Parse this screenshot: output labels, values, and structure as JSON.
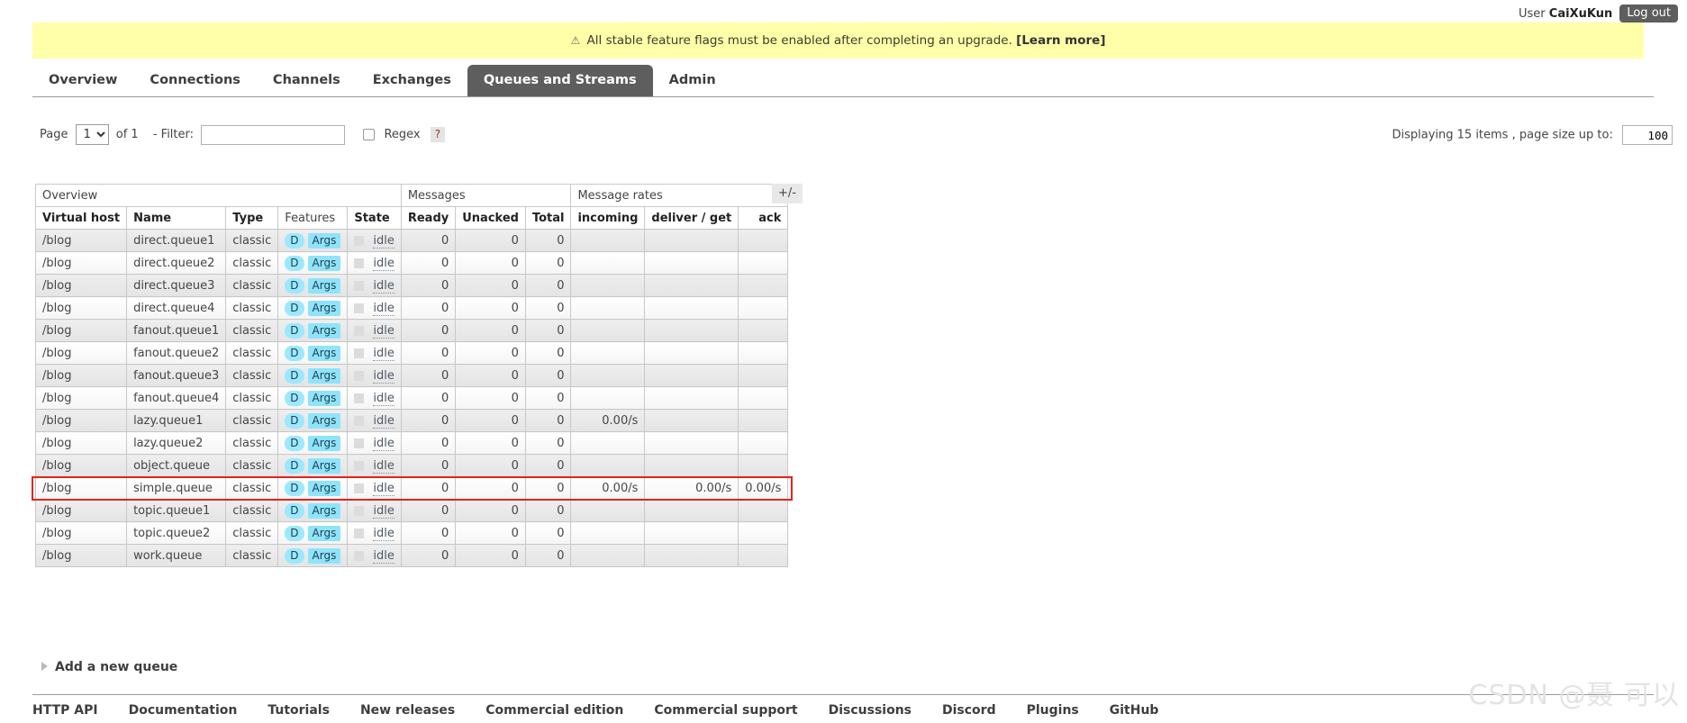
{
  "topbar": {
    "user_label": "User",
    "user_name": "CaiXuKun",
    "logout_label": "Log out"
  },
  "banner": {
    "warn_icon": "warning-triangle-icon",
    "warn_glyph": "⚠",
    "message": "All stable feature flags must be enabled after completing an upgrade.",
    "learn_more": "[Learn more]"
  },
  "tabs": [
    {
      "label": "Overview",
      "active": false
    },
    {
      "label": "Connections",
      "active": false
    },
    {
      "label": "Channels",
      "active": false
    },
    {
      "label": "Exchanges",
      "active": false
    },
    {
      "label": "Queues and Streams",
      "active": true
    },
    {
      "label": "Admin",
      "active": false
    }
  ],
  "filter": {
    "page_label": "Page",
    "page_value": "1",
    "page_options": [
      "1"
    ],
    "of_label": "of 1",
    "filter_label": "- Filter:",
    "filter_value": "",
    "filter_placeholder": "",
    "regex_label": "Regex",
    "regex_checked": false,
    "help_label": "?",
    "displaying_text": "Displaying 15 items , page size up to:",
    "page_size_value": "100"
  },
  "table": {
    "group_headers": [
      {
        "label": "Overview",
        "span": 5
      },
      {
        "label": "Messages",
        "span": 3
      },
      {
        "label": "Message rates",
        "span": 3
      }
    ],
    "plus_minus": "+/-",
    "columns": [
      {
        "label": "Virtual host",
        "bold": true,
        "align": "left"
      },
      {
        "label": "Name",
        "bold": true,
        "align": "left"
      },
      {
        "label": "Type",
        "bold": true,
        "align": "left"
      },
      {
        "label": "Features",
        "bold": false,
        "align": "left"
      },
      {
        "label": "State",
        "bold": true,
        "align": "left"
      },
      {
        "label": "Ready",
        "bold": true,
        "align": "right"
      },
      {
        "label": "Unacked",
        "bold": true,
        "align": "right"
      },
      {
        "label": "Total",
        "bold": true,
        "align": "right"
      },
      {
        "label": "incoming",
        "bold": true,
        "align": "right"
      },
      {
        "label": "deliver / get",
        "bold": true,
        "align": "right"
      },
      {
        "label": "ack",
        "bold": true,
        "align": "right"
      }
    ],
    "feature_badges": {
      "durable": "D",
      "args": "Args"
    },
    "state_text": "idle",
    "rows": [
      {
        "vhost": "/blog",
        "name": "direct.queue1",
        "type": "classic",
        "state": "idle",
        "ready": "0",
        "unacked": "0",
        "total": "0",
        "incoming": "",
        "deliver_get": "",
        "ack": "",
        "highlighted": false
      },
      {
        "vhost": "/blog",
        "name": "direct.queue2",
        "type": "classic",
        "state": "idle",
        "ready": "0",
        "unacked": "0",
        "total": "0",
        "incoming": "",
        "deliver_get": "",
        "ack": "",
        "highlighted": false
      },
      {
        "vhost": "/blog",
        "name": "direct.queue3",
        "type": "classic",
        "state": "idle",
        "ready": "0",
        "unacked": "0",
        "total": "0",
        "incoming": "",
        "deliver_get": "",
        "ack": "",
        "highlighted": false
      },
      {
        "vhost": "/blog",
        "name": "direct.queue4",
        "type": "classic",
        "state": "idle",
        "ready": "0",
        "unacked": "0",
        "total": "0",
        "incoming": "",
        "deliver_get": "",
        "ack": "",
        "highlighted": false
      },
      {
        "vhost": "/blog",
        "name": "fanout.queue1",
        "type": "classic",
        "state": "idle",
        "ready": "0",
        "unacked": "0",
        "total": "0",
        "incoming": "",
        "deliver_get": "",
        "ack": "",
        "highlighted": false
      },
      {
        "vhost": "/blog",
        "name": "fanout.queue2",
        "type": "classic",
        "state": "idle",
        "ready": "0",
        "unacked": "0",
        "total": "0",
        "incoming": "",
        "deliver_get": "",
        "ack": "",
        "highlighted": false
      },
      {
        "vhost": "/blog",
        "name": "fanout.queue3",
        "type": "classic",
        "state": "idle",
        "ready": "0",
        "unacked": "0",
        "total": "0",
        "incoming": "",
        "deliver_get": "",
        "ack": "",
        "highlighted": false
      },
      {
        "vhost": "/blog",
        "name": "fanout.queue4",
        "type": "classic",
        "state": "idle",
        "ready": "0",
        "unacked": "0",
        "total": "0",
        "incoming": "",
        "deliver_get": "",
        "ack": "",
        "highlighted": false
      },
      {
        "vhost": "/blog",
        "name": "lazy.queue1",
        "type": "classic",
        "state": "idle",
        "ready": "0",
        "unacked": "0",
        "total": "0",
        "incoming": "0.00/s",
        "deliver_get": "",
        "ack": "",
        "highlighted": false
      },
      {
        "vhost": "/blog",
        "name": "lazy.queue2",
        "type": "classic",
        "state": "idle",
        "ready": "0",
        "unacked": "0",
        "total": "0",
        "incoming": "",
        "deliver_get": "",
        "ack": "",
        "highlighted": false
      },
      {
        "vhost": "/blog",
        "name": "object.queue",
        "type": "classic",
        "state": "idle",
        "ready": "0",
        "unacked": "0",
        "total": "0",
        "incoming": "",
        "deliver_get": "",
        "ack": "",
        "highlighted": false
      },
      {
        "vhost": "/blog",
        "name": "simple.queue",
        "type": "classic",
        "state": "idle",
        "ready": "0",
        "unacked": "0",
        "total": "0",
        "incoming": "0.00/s",
        "deliver_get": "0.00/s",
        "ack": "0.00/s",
        "highlighted": true
      },
      {
        "vhost": "/blog",
        "name": "topic.queue1",
        "type": "classic",
        "state": "idle",
        "ready": "0",
        "unacked": "0",
        "total": "0",
        "incoming": "",
        "deliver_get": "",
        "ack": "",
        "highlighted": false
      },
      {
        "vhost": "/blog",
        "name": "topic.queue2",
        "type": "classic",
        "state": "idle",
        "ready": "0",
        "unacked": "0",
        "total": "0",
        "incoming": "",
        "deliver_get": "",
        "ack": "",
        "highlighted": false
      },
      {
        "vhost": "/blog",
        "name": "work.queue",
        "type": "classic",
        "state": "idle",
        "ready": "0",
        "unacked": "0",
        "total": "0",
        "incoming": "",
        "deliver_get": "",
        "ack": "",
        "highlighted": false
      }
    ]
  },
  "add_queue": {
    "label": "Add a new queue",
    "icon": "triangle-right-icon"
  },
  "footer": {
    "links": [
      "HTTP API",
      "Documentation",
      "Tutorials",
      "New releases",
      "Commercial edition",
      "Commercial support",
      "Discussions",
      "Discord",
      "Plugins",
      "GitHub"
    ]
  },
  "watermark": {
    "text": "CSDN @聂 可以"
  },
  "colors": {
    "banner_bg": "#ffffaa",
    "active_tab_bg": "#5e5e5e",
    "badge_cyan": "#8fe3fb",
    "highlight_border": "#e8221a"
  }
}
